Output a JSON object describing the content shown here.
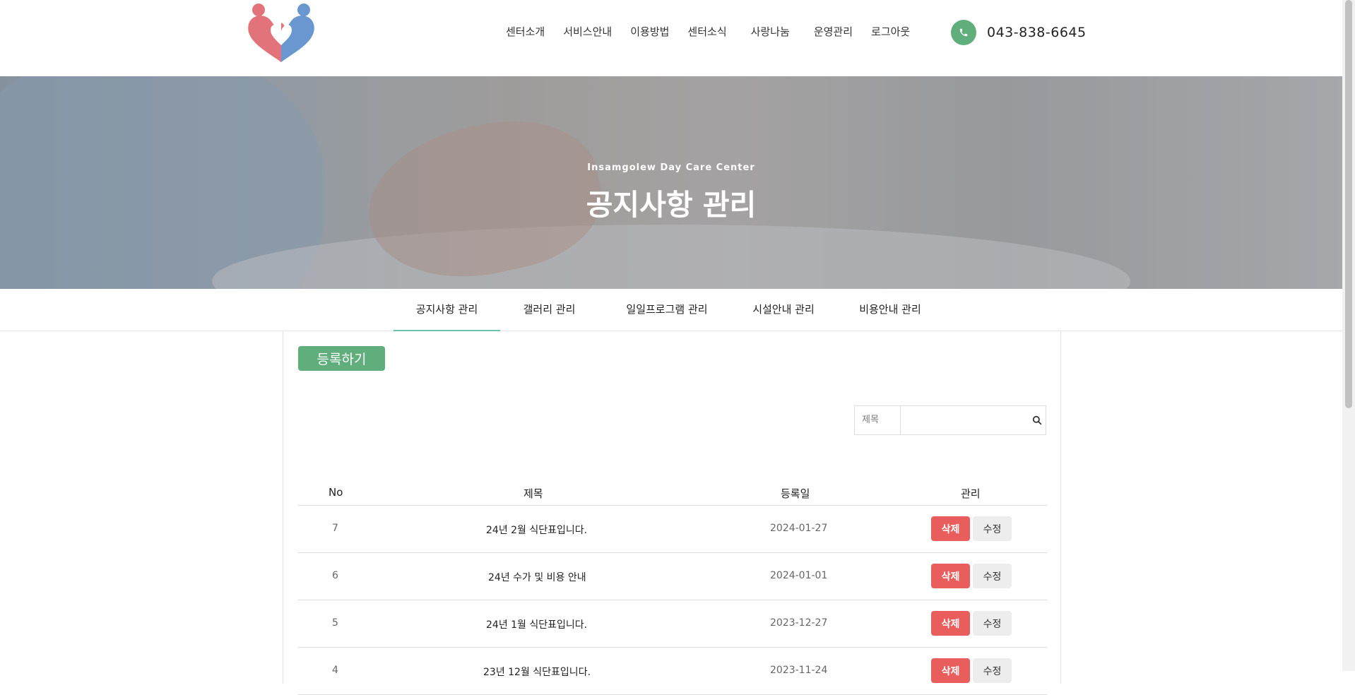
{
  "header": {
    "nav": [
      "센터소개",
      "서비스안내",
      "이용방법",
      "센터소식",
      "사랑나눔",
      "운영관리",
      "로그아웃"
    ],
    "phone": "043-838-6645"
  },
  "hero": {
    "subtitle": "Insamgolew Day Care Center",
    "title": "공지사항 관리"
  },
  "tabs": [
    "공지사항 관리",
    "갤러리 관리",
    "일일프로그램 관리",
    "시설안내 관리",
    "비용안내 관리"
  ],
  "actions": {
    "register": "등록하기"
  },
  "search": {
    "field": "제목",
    "value": ""
  },
  "table": {
    "headers": [
      "No",
      "제목",
      "등록일",
      "관리"
    ],
    "rows": [
      {
        "no": "7",
        "title": "24년 2월 식단표입니다.",
        "date": "2024-01-27",
        "delete": "삭제",
        "edit": "수정"
      },
      {
        "no": "6",
        "title": "24년 수가 및 비용 안내",
        "date": "2024-01-01",
        "delete": "삭제",
        "edit": "수정"
      },
      {
        "no": "5",
        "title": "24년 1월 식단표입니다.",
        "date": "2023-12-27",
        "delete": "삭제",
        "edit": "수정"
      },
      {
        "no": "4",
        "title": "23년 12월 식단표입니다.",
        "date": "2023-11-24",
        "delete": "삭제",
        "edit": "수정"
      }
    ]
  },
  "colors": {
    "accent_green": "#5fae7c",
    "delete_red": "#ea5d5d",
    "tab_active": "#66c2b3"
  }
}
